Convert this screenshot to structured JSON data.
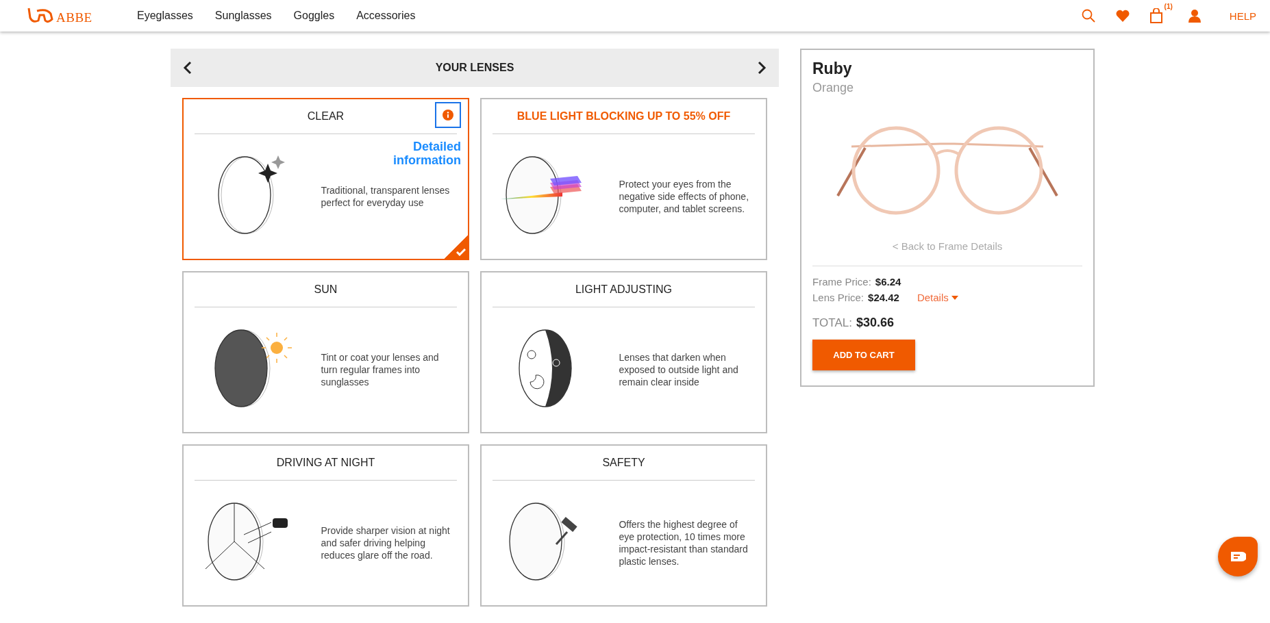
{
  "header": {
    "logo": "ABBE",
    "nav": [
      "Eyeglasses",
      "Sunglasses",
      "Goggles",
      "Accessories"
    ],
    "cart_count": "(1)",
    "help": "HELP"
  },
  "lenses": {
    "title": "YOUR LENSES",
    "cards": [
      {
        "kind": "clear",
        "title": "CLEAR",
        "promo": false,
        "selected": true,
        "tooltip": "Detailed information",
        "description": "Traditional, transparent lenses perfect for everyday use"
      },
      {
        "kind": "blue",
        "title": "BLUE LIGHT BLOCKING UP TO 55% OFF",
        "promo": true,
        "selected": false,
        "description": "Protect your eyes from the negative side effects of phone, computer, and tablet screens."
      },
      {
        "kind": "sun",
        "title": "SUN",
        "promo": false,
        "selected": false,
        "description": "Tint or coat your lenses and turn regular frames into sunglasses"
      },
      {
        "kind": "adjust",
        "title": "LIGHT ADJUSTING",
        "promo": false,
        "selected": false,
        "description": "Lenses that darken when exposed to outside light and remain clear inside"
      },
      {
        "kind": "night",
        "title": "DRIVING AT NIGHT",
        "promo": false,
        "selected": false,
        "description": "Provide sharper vision at night and safer driving helping reduces glare off the road."
      },
      {
        "kind": "safety",
        "title": "SAFETY",
        "promo": false,
        "selected": false,
        "description": "Offers the highest degree of eye protection, 10 times more impact-resistant than standard plastic lenses."
      }
    ]
  },
  "summary": {
    "name": "Ruby",
    "variant": "Orange",
    "back_link": "< Back to Frame Details",
    "frame_label": "Frame Price:",
    "frame_price": "$6.24",
    "lens_label": "Lens Price:",
    "lens_price": "$24.42",
    "details": "Details",
    "total_label": "TOTAL:",
    "total": "$30.66",
    "button": "ADD TO CART"
  }
}
